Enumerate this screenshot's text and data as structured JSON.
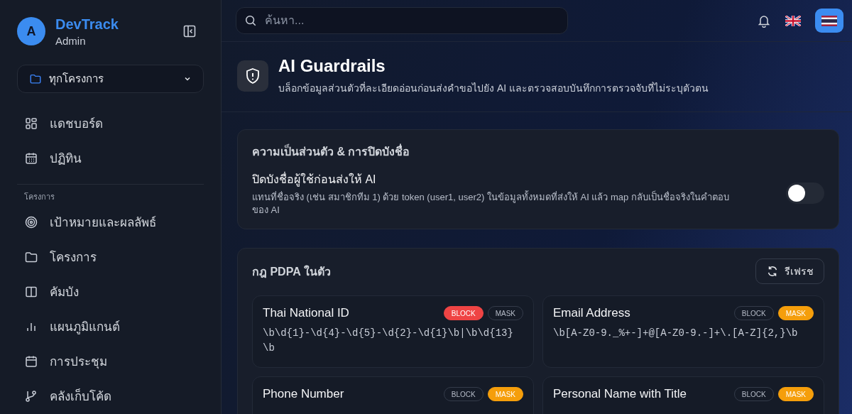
{
  "sidebar": {
    "avatar": "A",
    "app_name": "DevTrack",
    "role": "Admin",
    "project_picker": "ทุกโครงการ",
    "items": [
      {
        "label": "แดชบอร์ด"
      },
      {
        "label": "ปฏิทิน"
      }
    ],
    "section": {
      "title": "โครงการ",
      "items": [
        {
          "label": "เป้าหมายและผลลัพธ์"
        },
        {
          "label": "โครงการ"
        },
        {
          "label": "คัมบัง"
        },
        {
          "label": "แผนภูมิแกนต์"
        },
        {
          "label": "การประชุม"
        },
        {
          "label": "คลังเก็บโค้ด"
        }
      ]
    }
  },
  "topbar": {
    "search": {
      "placeholder": "ค้นหา..."
    },
    "languages": [
      {
        "selected": false
      },
      {
        "selected": true
      }
    ]
  },
  "header": {
    "title": "AI Guardrails",
    "subtitle": "บล็อกข้อมูลส่วนตัวที่ละเอียดอ่อนก่อนส่งคำขอไปยัง AI และตรวจสอบบันทึกการตรวจจับที่ไม่ระบุตัวตน"
  },
  "privacy": {
    "title": "ความเป็นส่วนตัว & การปิดบังชื่อ",
    "setting": {
      "label": "ปิดบังชื่อผู้ใช้ก่อนส่งให้ AI",
      "description": "แทนที่ชื่อจริง (เช่น สมาชิกทีม 1) ด้วย token (user1, user2) ในข้อมูลทั้งหมดที่ส่งให้ AI แล้ว map กลับเป็นชื่อจริงในคำตอบของ AI",
      "on": false
    }
  },
  "rules": {
    "title": "กฎ PDPA ในตัว",
    "refresh": "รีเฟรช",
    "items": [
      {
        "name": "Thai National ID",
        "pattern": "\\b\\d{1}-\\d{4}-\\d{5}-\\d{2}-\\d{1}\\b|\\b\\d{13}\\b",
        "actions": [
          {
            "label": "BLOCK",
            "kind": "block",
            "selected": true
          },
          {
            "label": "MASK",
            "kind": "mask",
            "selected": false
          }
        ]
      },
      {
        "name": "Email Address",
        "pattern": "\\b[A-Z0-9._%+-]+@[A-Z0-9.-]+\\.[A-Z]{2,}\\b",
        "actions": [
          {
            "label": "BLOCK",
            "kind": "block",
            "selected": false
          },
          {
            "label": "MASK",
            "kind": "mask",
            "selected": true
          }
        ]
      },
      {
        "name": "Phone Number",
        "actions": [
          {
            "label": "BLOCK",
            "kind": "block",
            "selected": false
          },
          {
            "label": "MASK",
            "kind": "mask",
            "selected": true
          }
        ]
      },
      {
        "name": "Personal Name with Title",
        "actions": [
          {
            "label": "BLOCK",
            "kind": "block",
            "selected": false
          },
          {
            "label": "MASK",
            "kind": "mask",
            "selected": true
          }
        ]
      }
    ]
  }
}
